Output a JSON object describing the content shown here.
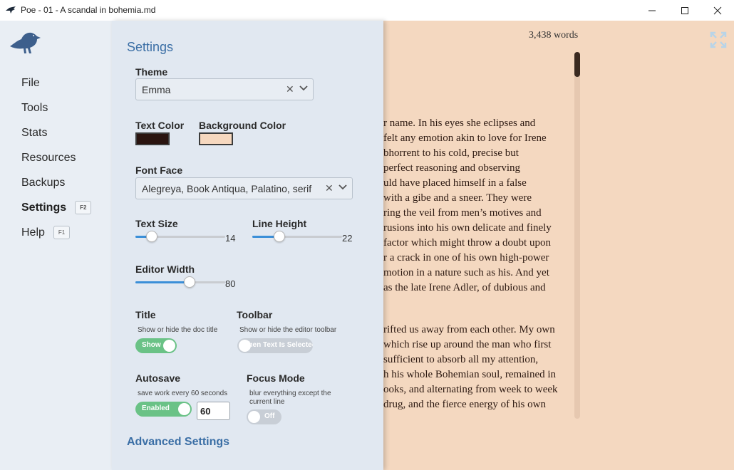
{
  "window": {
    "title": "Poe - 01 - A scandal in bohemia.md",
    "minimize_icon": "minimize-icon",
    "maximize_icon": "maximize-icon",
    "close_icon": "close-icon"
  },
  "nav": {
    "items": [
      {
        "label": "File"
      },
      {
        "label": "Tools"
      },
      {
        "label": "Stats"
      },
      {
        "label": "Resources"
      },
      {
        "label": "Backups"
      },
      {
        "label": "Settings",
        "shortcut": "F2",
        "active": true
      },
      {
        "label": "Help",
        "shortcut": "F1"
      }
    ]
  },
  "settings": {
    "title": "Settings",
    "theme": {
      "label": "Theme",
      "value": "Emma"
    },
    "text_color": {
      "label": "Text Color",
      "color": "#2a1410"
    },
    "background_color": {
      "label": "Background Color",
      "color": "#f6d8bf"
    },
    "font_face": {
      "label": "Font Face",
      "value": "Alegreya, Book Antiqua, Palatino, serif"
    },
    "text_size": {
      "label": "Text Size",
      "value": "14",
      "fraction": 0.18
    },
    "line_height": {
      "label": "Line Height",
      "value": "22",
      "fraction": 0.3
    },
    "editor_width": {
      "label": "Editor Width",
      "value": "80",
      "fraction": 0.6
    },
    "title_toggle": {
      "label": "Title",
      "description": "Show or hide the doc title",
      "state": "Show"
    },
    "toolbar_toggle": {
      "label": "Toolbar",
      "description": "Show or hide the editor toolbar",
      "state": "When Text Is Selected"
    },
    "autosave": {
      "label": "Autosave",
      "description": "save work every 60 seconds",
      "state": "Enabled",
      "seconds": "60"
    },
    "focus_mode": {
      "label": "Focus Mode",
      "description_line1": "blur everything except the",
      "description_line2": "current line",
      "state": "Off"
    },
    "advanced": "Advanced Settings"
  },
  "editor": {
    "word_count": "3,438 words",
    "background": "#f4d8c0",
    "paragraph1": [
      "r name. In his eyes she eclipses and",
      "felt any emotion akin to love for Irene",
      "bhorrent to his cold, precise but",
      "perfect reasoning and observing",
      "uld have placed himself in a false",
      "with a gibe and a sneer. They were",
      "ring the veil from men’s motives and",
      "rusions into his own delicate and finely",
      "factor which might throw a doubt upon",
      "r a crack in one of his own high-power",
      "motion in a nature such as his. And yet",
      "as the late Irene Adler, of dubious and"
    ],
    "paragraph2": [
      "rifted us away from each other. My own",
      "which rise up around the man who first",
      "sufficient to absorb all my attention,",
      "h his whole Bohemian soul, remained in",
      "ooks, and alternating from week to week",
      "drug, and the fierce energy of his own"
    ]
  }
}
